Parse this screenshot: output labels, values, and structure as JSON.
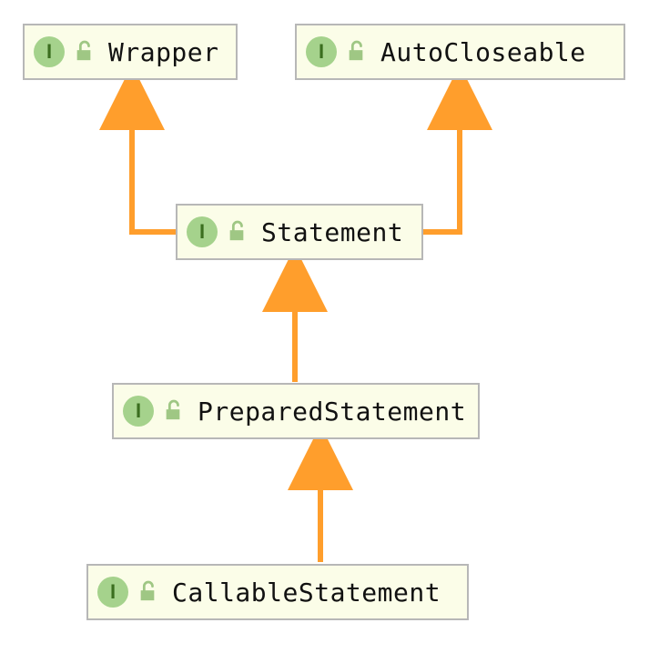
{
  "diagram": {
    "badge_letter": "I",
    "nodes": {
      "wrapper": {
        "label": "Wrapper"
      },
      "autocloseable": {
        "label": "AutoCloseable"
      },
      "statement": {
        "label": "Statement"
      },
      "preparedstatement": {
        "label": "PreparedStatement"
      },
      "callablestatement": {
        "label": "CallableStatement"
      }
    },
    "edges": [
      {
        "from": "statement",
        "to": "wrapper"
      },
      {
        "from": "statement",
        "to": "autocloseable"
      },
      {
        "from": "preparedstatement",
        "to": "statement"
      },
      {
        "from": "callablestatement",
        "to": "preparedstatement"
      }
    ],
    "colors": {
      "node_bg": "#fbfde8",
      "node_border": "#b7b7b7",
      "badge_bg": "#a5d28c",
      "badge_fg": "#3b6e1f",
      "arrow": "#ff9e2c",
      "lock": "#9fc784"
    }
  }
}
